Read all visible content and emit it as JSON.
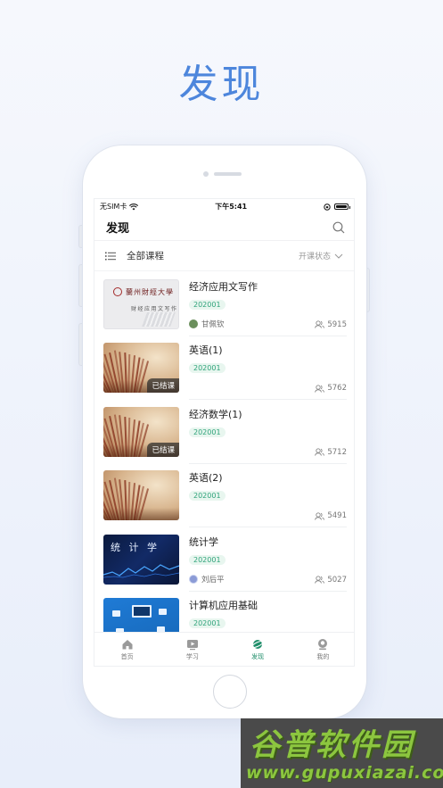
{
  "headline": "发现",
  "status_bar": {
    "carrier": "无SIM卡",
    "time": "下午5:41"
  },
  "navbar": {
    "title": "发现"
  },
  "filter": {
    "all_label": "全部课程",
    "status_label": "开课状态"
  },
  "courses": [
    {
      "name": "经济应用文写作",
      "term": "202001",
      "teacher": "甘佩钦",
      "count": "5915",
      "thumb": "university",
      "ended": "",
      "thumb_title": "蘭州財經大學",
      "thumb_sub": "财经应用文写作"
    },
    {
      "name": "英语(1)",
      "term": "202001",
      "teacher": "",
      "count": "5762",
      "thumb": "book",
      "ended": "已结课"
    },
    {
      "name": "经济数学(1)",
      "term": "202001",
      "teacher": "",
      "count": "5712",
      "thumb": "book",
      "ended": "已结课"
    },
    {
      "name": "英语(2)",
      "term": "202001",
      "teacher": "",
      "count": "5491",
      "thumb": "book",
      "ended": ""
    },
    {
      "name": "统计学",
      "term": "202001",
      "teacher": "刘后平",
      "count": "5027",
      "thumb": "stats",
      "ended": "",
      "thumb_title": "统 计 学"
    },
    {
      "name": "计算机应用基础",
      "term": "202001",
      "teacher": "",
      "count": "",
      "thumb": "computer",
      "ended": ""
    }
  ],
  "tabs": [
    {
      "label": "首页",
      "icon": "home-icon"
    },
    {
      "label": "学习",
      "icon": "play-icon"
    },
    {
      "label": "发现",
      "icon": "planet-icon",
      "active": true
    },
    {
      "label": "我的",
      "icon": "user-icon"
    }
  ],
  "watermark": {
    "top": "谷普软件园",
    "bottom": "www.gupuxiazai.com"
  },
  "colors": {
    "accent": "#1f8e6a",
    "headline": "#4d86dc",
    "term_bg": "#e8f6ef"
  }
}
